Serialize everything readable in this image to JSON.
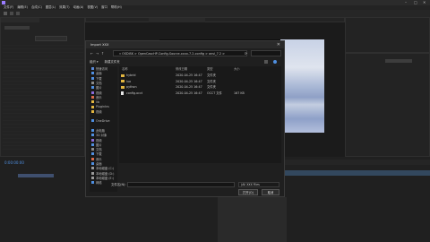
{
  "app": {
    "title": "",
    "menu": [
      "文件(F)",
      "编辑(E)",
      "合成(C)",
      "图层(L)",
      "效果(T)",
      "动画(A)",
      "视图(V)",
      "窗口",
      "帮助(H)"
    ]
  },
  "timecode": "0:00:00:00",
  "dialog": {
    "title": "Import XXX",
    "close_label": "✕",
    "address_path": "« OSDISK > OpenCascHP-Config-Source-xxxx-7.2-config > ansi_7.2 >",
    "nav_buttons": [
      "←",
      "→",
      "↑",
      "⟳"
    ],
    "command_bar": {
      "organize": "组织 ▾",
      "new_folder": "新建文件夹"
    },
    "nav_items": [
      {
        "label": "快速访问",
        "color": "#5a8ad8"
      },
      {
        "label": "桌面",
        "color": "#4f8fe0"
      },
      {
        "label": "下载",
        "color": "#4f8fe0"
      },
      {
        "label": "文档",
        "color": "#8a8a8a"
      },
      {
        "label": "图片",
        "color": "#4f8fe0"
      },
      {
        "label": "视频",
        "color": "#8a6ad8"
      },
      {
        "label": "音乐",
        "color": "#d86a4a"
      },
      {
        "label": "lib",
        "color": "#e2b640"
      },
      {
        "label": "PluginIns",
        "color": "#e2b640"
      },
      {
        "label": "视频",
        "color": "#e2b640"
      },
      {
        "label": "",
        "color": "#1a1a1a"
      },
      {
        "label": "OneDrive",
        "color": "#4f8fe0"
      },
      {
        "label": "",
        "color": "#1a1a1a"
      },
      {
        "label": "此电脑",
        "color": "#4f8fe0"
      },
      {
        "label": "3D 对象",
        "color": "#4f8fe0"
      },
      {
        "label": "视频",
        "color": "#8a6ad8"
      },
      {
        "label": "图片",
        "color": "#4f8fe0"
      },
      {
        "label": "文档",
        "color": "#8a8a8a"
      },
      {
        "label": "下载",
        "color": "#4f8fe0"
      },
      {
        "label": "音乐",
        "color": "#d86a4a"
      },
      {
        "label": "桌面",
        "color": "#4f8fe0"
      },
      {
        "label": "本地磁盘 (C:)",
        "color": "#9a9a9a"
      },
      {
        "label": "本地磁盘 (D:)",
        "color": "#9a9a9a"
      },
      {
        "label": "本地磁盘 (E:)",
        "color": "#9a9a9a"
      },
      {
        "label": "网络",
        "color": "#4f8fe0"
      }
    ],
    "columns": [
      "名称",
      "修改日期",
      "类型",
      "大小"
    ],
    "files": [
      {
        "name": "hybrid",
        "date": "2020-04-25 16:47",
        "type": "文件夹",
        "size": "",
        "kind": "folder"
      },
      {
        "name": "lua",
        "date": "2020-04-25 16:47",
        "type": "文件夹",
        "size": "",
        "kind": "folder"
      },
      {
        "name": "python",
        "date": "2020-04-25 16:47",
        "type": "文件夹",
        "size": "",
        "kind": "folder"
      },
      {
        "name": "config.occt",
        "date": "2020-04-25 16:47",
        "type": "OCCT 文件",
        "size": "167 KB",
        "kind": "file"
      }
    ],
    "filename_label": "文件名(N):",
    "filename_value": "",
    "filetype_value": "(All XXX Files",
    "open_button": "打开(O)",
    "cancel_button": "取消"
  }
}
